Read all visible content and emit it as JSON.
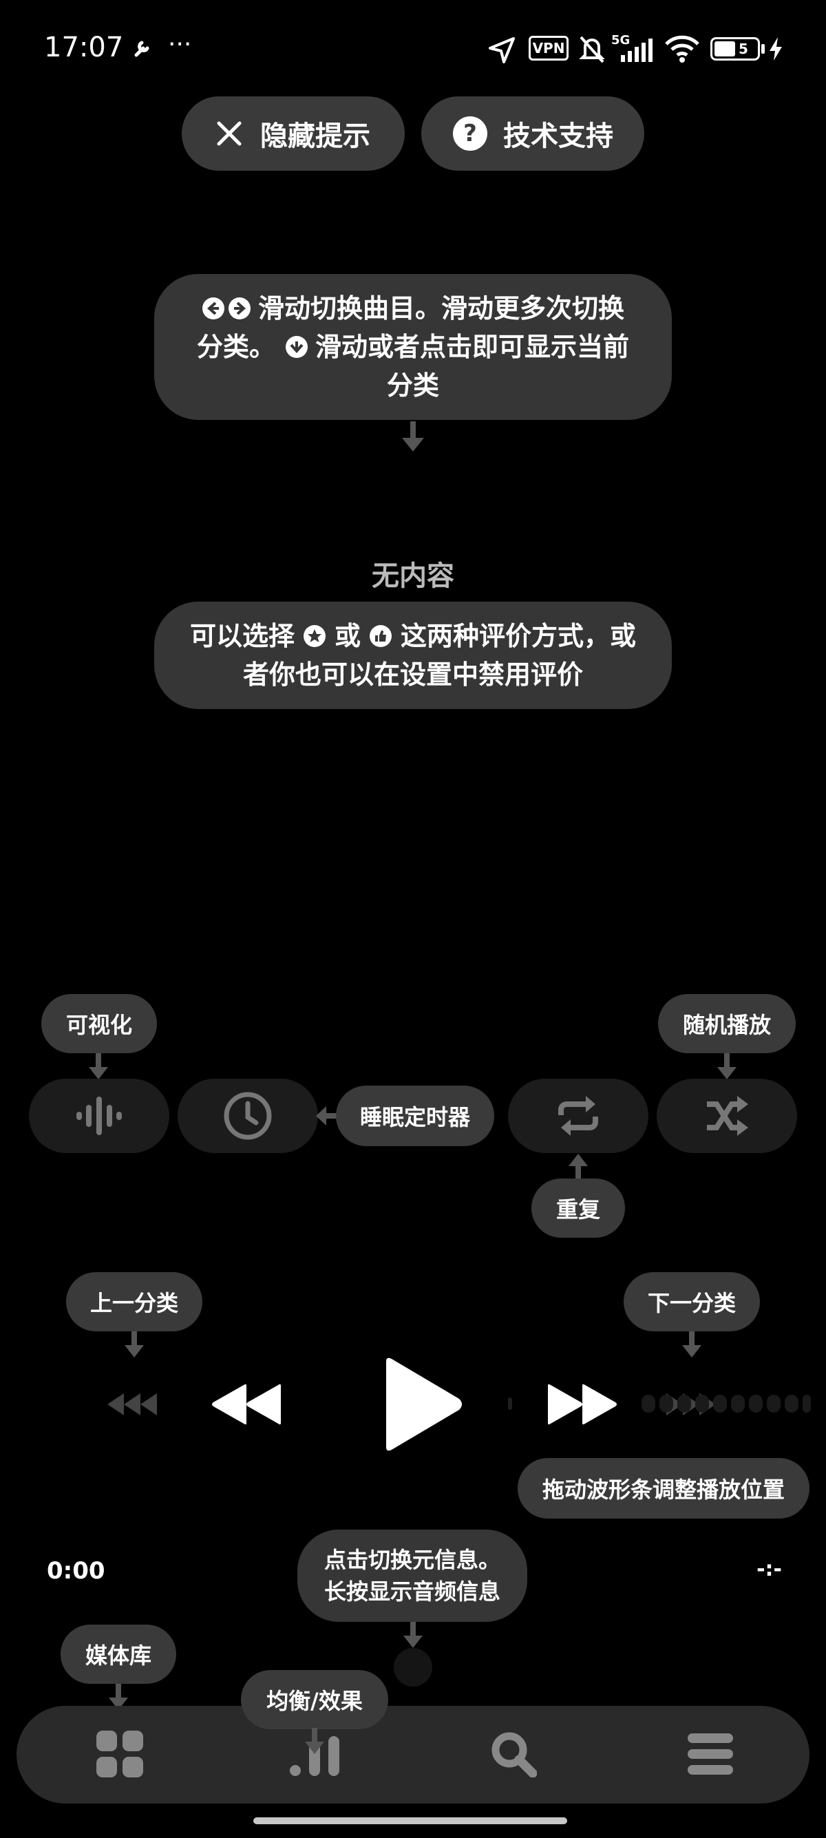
{
  "status_bar": {
    "time": "17:07",
    "dots": "···",
    "vpn": "VPN",
    "network": "5G",
    "battery": "5"
  },
  "top_buttons": {
    "hide_tips": "隐藏提示",
    "support": "技术支持"
  },
  "tips": {
    "swipe_line1": "滑动切换曲目。滑动更多次切换",
    "swipe_line2_prefix": "分类。",
    "swipe_line2_suffix": "滑动或者点击即可显示当前",
    "swipe_line3": "分类",
    "empty": "无内容",
    "rating_line1_a": "可以选择",
    "rating_line1_b": "或",
    "rating_line1_c": "这两种评价方式，或",
    "rating_line2": "者你也可以在设置中禁用评价",
    "visualize": "可视化",
    "shuffle": "随机播放",
    "sleep_timer": "睡眠定时器",
    "repeat": "重复",
    "prev_category": "上一分类",
    "next_category": "下一分类",
    "waveform": "拖动波形条调整播放位置",
    "meta_line1": "点击切换元信息。",
    "meta_line2": "长按显示音频信息",
    "library": "媒体库",
    "eq": "均衡/效果"
  },
  "player": {
    "elapsed": "0:00",
    "duration": "-:-"
  },
  "colors": {
    "background": "#000000",
    "pill": "#3a3a3a",
    "control": "#1c1c1c",
    "nav": "#2a2a2a"
  }
}
